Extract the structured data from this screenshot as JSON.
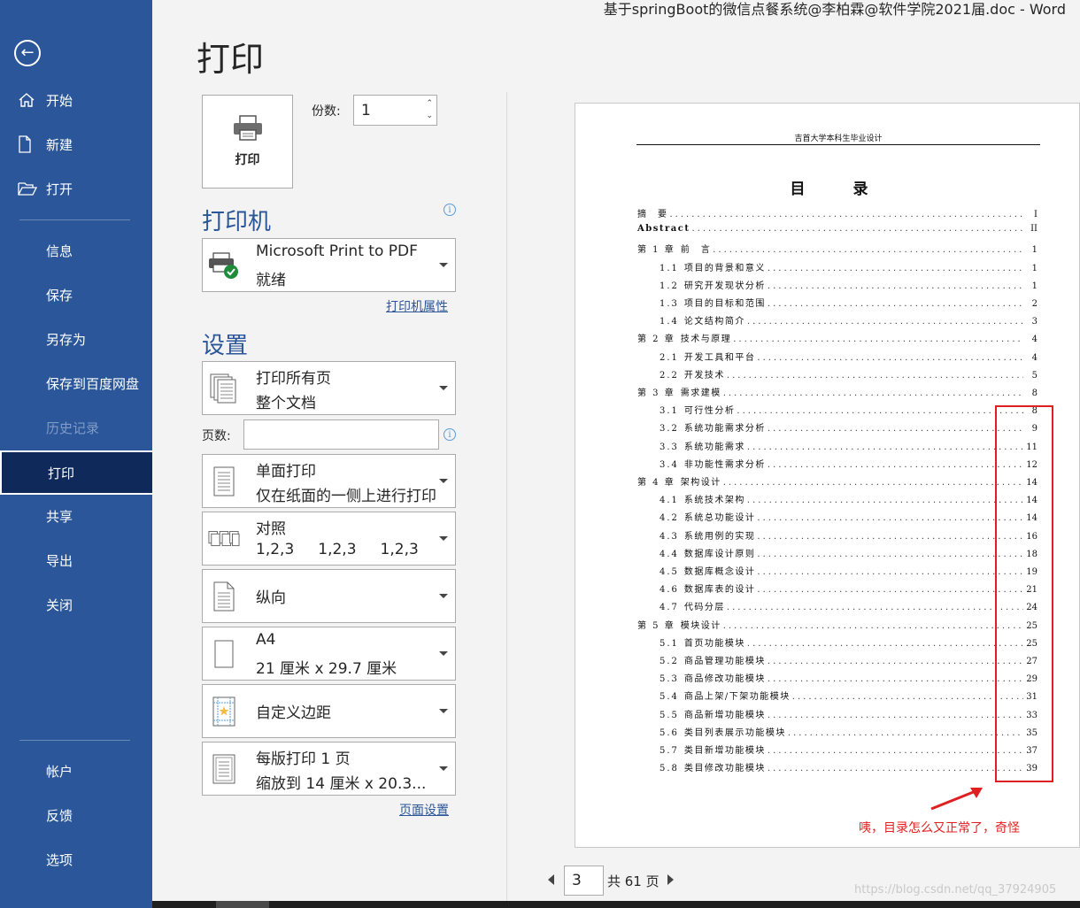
{
  "window": {
    "title": "基于springBoot的微信点餐系统@李柏霖@软件学院2021届.doc  -  Word"
  },
  "sidebar": {
    "items": [
      {
        "label": "开始"
      },
      {
        "label": "新建"
      },
      {
        "label": "打开"
      },
      {
        "label": "信息"
      },
      {
        "label": "保存"
      },
      {
        "label": "另存为"
      },
      {
        "label": "保存到百度网盘"
      },
      {
        "label": "历史记录"
      },
      {
        "label": "打印"
      },
      {
        "label": "共享"
      },
      {
        "label": "导出"
      },
      {
        "label": "关闭"
      },
      {
        "label": "帐户"
      },
      {
        "label": "反馈"
      },
      {
        "label": "选项"
      }
    ]
  },
  "main": {
    "title": "打印",
    "print_button": "打印",
    "copies_label": "份数:",
    "copies_value": "1"
  },
  "printer": {
    "section_title": "打印机",
    "name": "Microsoft Print to PDF",
    "status": "就绪",
    "properties_link": "打印机属性"
  },
  "settings": {
    "section_title": "设置",
    "pages_label": "页数:",
    "page_setup_link": "页面设置",
    "dropdowns": [
      {
        "line1": "打印所有页",
        "line2": "整个文档",
        "icon": "pages-icon"
      },
      {
        "line1": "单面打印",
        "line2": "仅在纸面的一侧上进行打印",
        "icon": "one-sided-icon"
      },
      {
        "line1": "对照",
        "line2": "1,2,3     1,2,3     1,2,3",
        "icon": "collate-icon"
      },
      {
        "line1": "纵向",
        "line2": "",
        "icon": "portrait-icon"
      },
      {
        "line1": "A4",
        "line2": "21 厘米 x 29.7 厘米",
        "icon": "paper-size-icon"
      },
      {
        "line1": "自定义边距",
        "line2": "",
        "icon": "margins-icon"
      },
      {
        "line1": "每版打印 1 页",
        "line2": "缩放到 14 厘米 x 20.3...",
        "icon": "pages-per-sheet-icon"
      }
    ]
  },
  "preview": {
    "header": "吉首大学本科生毕业设计",
    "toc_title": "目 录",
    "entries": [
      {
        "level": 1,
        "num": "",
        "text": "摘　要",
        "page": "I"
      },
      {
        "level": 1,
        "num": "",
        "text": "Abstract",
        "page": "II",
        "bold": true
      },
      {
        "level": 1,
        "num": "第 1 章",
        "text": "前　言",
        "page": "1"
      },
      {
        "level": 2,
        "num": "1.1",
        "text": "项目的背景和意义",
        "page": "1"
      },
      {
        "level": 2,
        "num": "1.2",
        "text": "研究开发现状分析",
        "page": "1"
      },
      {
        "level": 2,
        "num": "1.3",
        "text": "项目的目标和范围",
        "page": "2"
      },
      {
        "level": 2,
        "num": "1.4",
        "text": "论文结构简介",
        "page": "3"
      },
      {
        "level": 1,
        "num": "第 2 章",
        "text": "技术与原理",
        "page": "4"
      },
      {
        "level": 2,
        "num": "2.1",
        "text": "开发工具和平台",
        "page": "4"
      },
      {
        "level": 2,
        "num": "2.2",
        "text": "开发技术",
        "page": "5"
      },
      {
        "level": 1,
        "num": "第 3 章",
        "text": "需求建模",
        "page": "8"
      },
      {
        "level": 2,
        "num": "3.1",
        "text": "可行性分析",
        "page": "8"
      },
      {
        "level": 2,
        "num": "3.2",
        "text": "系统功能需求分析",
        "page": "9"
      },
      {
        "level": 2,
        "num": "3.3",
        "text": "系统功能需求",
        "page": "11"
      },
      {
        "level": 2,
        "num": "3.4",
        "text": "非功能性需求分析",
        "page": "12"
      },
      {
        "level": 1,
        "num": "第 4 章",
        "text": "架构设计",
        "page": "14"
      },
      {
        "level": 2,
        "num": "4.1",
        "text": "系统技术架构",
        "page": "14"
      },
      {
        "level": 2,
        "num": "4.2",
        "text": "系统总功能设计",
        "page": "14"
      },
      {
        "level": 2,
        "num": "4.3",
        "text": "系统用例的实现",
        "page": "16"
      },
      {
        "level": 2,
        "num": "4.4",
        "text": "数据库设计原则",
        "page": "18"
      },
      {
        "level": 2,
        "num": "4.5",
        "text": "数据库概念设计",
        "page": "19"
      },
      {
        "level": 2,
        "num": "4.6",
        "text": "数据库表的设计",
        "page": "21"
      },
      {
        "level": 2,
        "num": "4.7",
        "text": "代码分层",
        "page": "24"
      },
      {
        "level": 1,
        "num": "第 5 章",
        "text": "模块设计",
        "page": "25"
      },
      {
        "level": 2,
        "num": "5.1",
        "text": "首页功能模块",
        "page": "25"
      },
      {
        "level": 2,
        "num": "5.2",
        "text": "商品管理功能模块",
        "page": "27"
      },
      {
        "level": 2,
        "num": "5.3",
        "text": "商品修改功能模块",
        "page": "29"
      },
      {
        "level": 2,
        "num": "5.4",
        "text": "商品上架/下架功能模块",
        "page": "31"
      },
      {
        "level": 2,
        "num": "5.5",
        "text": "商品新增功能模块",
        "page": "33"
      },
      {
        "level": 2,
        "num": "5.6",
        "text": "类目列表展示功能模块",
        "page": "35"
      },
      {
        "level": 2,
        "num": "5.7",
        "text": "类目新增功能模块",
        "page": "37"
      },
      {
        "level": 2,
        "num": "5.8",
        "text": "类目修改功能模块",
        "page": "39"
      }
    ],
    "annotation": "咦，目录怎么又正常了，奇怪",
    "annotation_color": "#e02020"
  },
  "page_nav": {
    "current": "3",
    "total": "共 61 页"
  },
  "watermark": "https://blog.csdn.net/qq_37924905",
  "colors": {
    "sidebar": "#2b579a",
    "active": "#0f2a5a",
    "accent": "#2b579a"
  }
}
